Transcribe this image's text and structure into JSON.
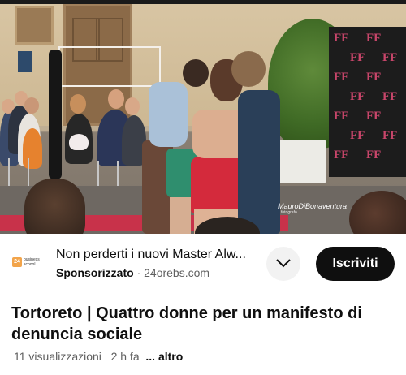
{
  "video": {
    "watermark_name": "MauroDiBonaventura",
    "watermark_sub": "fotografo",
    "backdrop_letters": "FF"
  },
  "ad": {
    "logo_mark": "24",
    "logo_text": "business school",
    "title": "Non perderti i nuovi Master Alw...",
    "sponsored_label": "Sponsorizzato",
    "separator": "·",
    "domain": "24orebs.com",
    "expand_icon": "chevron-down-icon",
    "subscribe_label": "Iscriviti"
  },
  "video_info": {
    "title": "Tortoreto | Quattro donne per un manifesto di denuncia sociale",
    "views": "11 visualizzazioni",
    "age": "2 h fa",
    "more_label": "... altro"
  },
  "colors": {
    "subscribe_bg": "#0f0f0f",
    "text_primary": "#0f0f0f",
    "text_secondary": "#606060",
    "carpet": "#c8324a"
  }
}
